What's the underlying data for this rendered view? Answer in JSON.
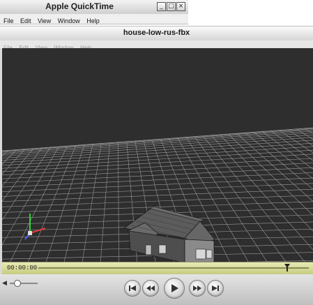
{
  "outer_window": {
    "title": "Apple QuickTime",
    "buttons": {
      "minimize": "_",
      "maximize": "□",
      "close": "×"
    },
    "menu": [
      "File",
      "Edit",
      "View",
      "Window",
      "Help"
    ]
  },
  "movie_window": {
    "title": "house-low-rus-fbx",
    "menu": [
      "File",
      "Edit",
      "View",
      "Window",
      "Help"
    ]
  },
  "controller": {
    "current_time": "00:00:00",
    "playhead_fraction": 0.92,
    "volume_fraction": 0.2
  },
  "colors": {
    "viewport_bg": "#2e2e2e",
    "timeline_bg": "#d8dc9a",
    "grid_line": "#9a9a9a"
  },
  "icons": {
    "volume": "speaker-icon",
    "buttons": [
      "go-to-start-icon",
      "rewind-icon",
      "play-icon",
      "fast-forward-icon",
      "go-to-end-icon"
    ]
  }
}
